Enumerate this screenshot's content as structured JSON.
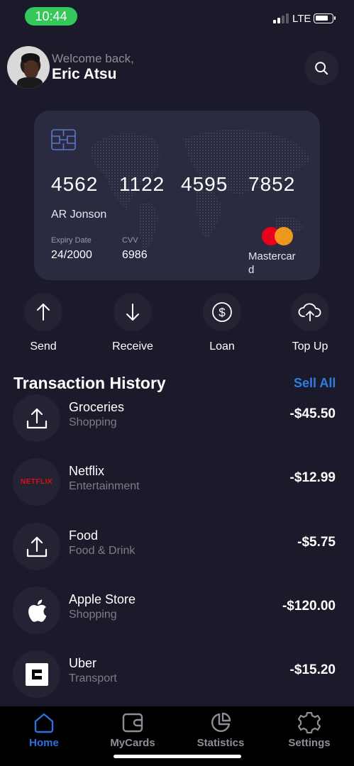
{
  "status_bar": {
    "time": "10:44",
    "network": "LTE"
  },
  "header": {
    "welcome": "Welcome back,",
    "user_name": "Eric Atsu"
  },
  "card": {
    "number_groups": [
      "4562",
      "1122",
      "4595",
      "7852"
    ],
    "holder": "AR Jonson",
    "expiry_label": "Expiry Date",
    "expiry_value": "24/2000",
    "cvv_label": "CVV",
    "cvv_value": "6986",
    "brand": "Mastercard"
  },
  "actions": [
    {
      "label": "Send",
      "icon": "arrow-up-icon"
    },
    {
      "label": "Receive",
      "icon": "arrow-down-icon"
    },
    {
      "label": "Loan",
      "icon": "dollar-icon"
    },
    {
      "label": "Top Up",
      "icon": "cloud-upload-icon"
    }
  ],
  "transactions": {
    "title": "Transaction History",
    "see_all": "Sell All",
    "items": [
      {
        "name": "Groceries",
        "category": "Shopping",
        "amount": "-$45.50",
        "icon": "upload-icon"
      },
      {
        "name": "Netflix",
        "category": "Entertainment",
        "amount": "-$12.99",
        "icon": "netflix-logo",
        "logo_text": "NETFLIX"
      },
      {
        "name": "Food",
        "category": "Food & Drink",
        "amount": "-$5.75",
        "icon": "upload-icon"
      },
      {
        "name": "Apple Store",
        "category": "Shopping",
        "amount": "-$120.00",
        "icon": "apple-icon"
      },
      {
        "name": "Uber",
        "category": "Transport",
        "amount": "-$15.20",
        "icon": "uber-icon"
      }
    ]
  },
  "nav": [
    {
      "label": "Home",
      "icon": "home-icon",
      "active": true
    },
    {
      "label": "MyCards",
      "icon": "wallet-icon",
      "active": false
    },
    {
      "label": "Statistics",
      "icon": "pie-chart-icon",
      "active": false
    },
    {
      "label": "Settings",
      "icon": "gear-icon",
      "active": false
    }
  ],
  "colors": {
    "background": "#1a1a2a",
    "accent": "#2f7de1",
    "card": "#2a2b40",
    "status_pill": "#34c759"
  }
}
